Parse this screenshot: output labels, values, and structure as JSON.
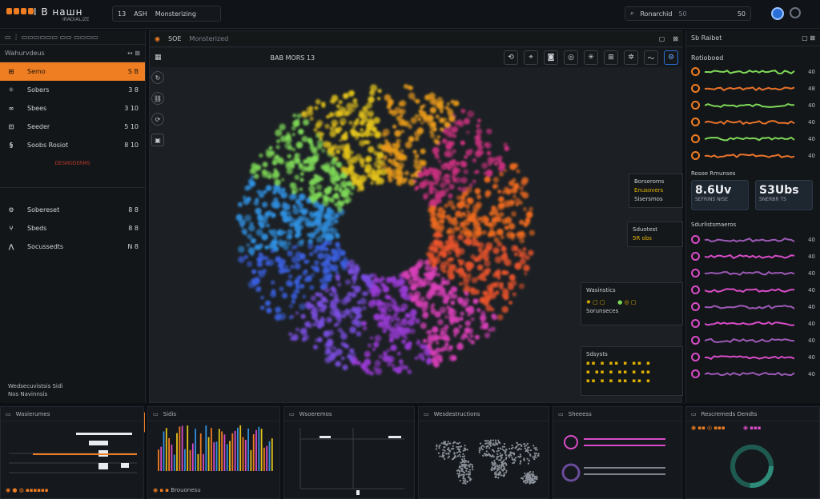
{
  "app": {
    "title": "I B нашн",
    "subtitle": "IRADIAL/ZE"
  },
  "project": {
    "left": "13",
    "center": "ASH",
    "right": "Monsterizing"
  },
  "search": {
    "placeholder": "Ronarchid",
    "shortcut": "50",
    "count": "50"
  },
  "sidebar": {
    "header": "Wahurvdeus",
    "header_ctrl1": "↔",
    "header_ctrl2": "⊠",
    "items": [
      {
        "label": "Semo",
        "value": "S B",
        "active": true
      },
      {
        "label": "Sobers",
        "value": "3 8"
      },
      {
        "label": "Sbees",
        "value": "3 10"
      },
      {
        "label": "Seeder",
        "value": "5 10"
      },
      {
        "label": "Soobs Rosiot",
        "value": "8 10"
      }
    ],
    "group_label": "DESMODERMS",
    "items2": [
      {
        "label": "Sobereset",
        "value": "8 8"
      },
      {
        "label": "Sbeds",
        "value": "8 8"
      },
      {
        "label": "Socussedts",
        "value": "N 8"
      }
    ],
    "footer_line1": "Wedsecuvistsis Sidi",
    "footer_line2": "Nos Navinnsis"
  },
  "viewport": {
    "tab_label": "SOE",
    "tab_sub": "Monsterized",
    "toolbar_title": "BAB MORS 13",
    "overlay1": {
      "title": "Borseroms",
      "l1": "Enusovers",
      "l2": "Sisersmos"
    },
    "overlay2": {
      "title": "Sduotest",
      "l1": "5R obs"
    },
    "overlay3": {
      "title": "Wasinstics",
      "l1": "Sorunseces"
    },
    "overlay4": {
      "title": "Sdsysts"
    }
  },
  "rpanel": {
    "header": "Sb Raibet",
    "sec1": "Rotioboed",
    "sec2": "Rosoe Rmunses",
    "sec3": "Sdurlistsmaeros",
    "stat1": {
      "n": "8.6Uv",
      "s": "SEFRINS NISE"
    },
    "stat2": {
      "n": "S3Ubs",
      "s": "SNERBR TS"
    },
    "tracks1": [
      "40",
      "48",
      "40",
      "40",
      "40",
      "40"
    ],
    "tracks2": [
      "40",
      "40",
      "40",
      "40",
      "40",
      "40",
      "40",
      "40",
      "40"
    ],
    "colors": {
      "accent": "#ef7d22",
      "magenta": "#d84cc8",
      "green": "#7ed957"
    }
  },
  "bottom": {
    "p1": "Wasierumes",
    "p2": "Sidis",
    "p3": "Wsoeremos",
    "p4": "Wesdestructions",
    "p5": "Sheeess",
    "p6": "Rescremeds Dendts",
    "p2_foot": "Brouonesu"
  }
}
